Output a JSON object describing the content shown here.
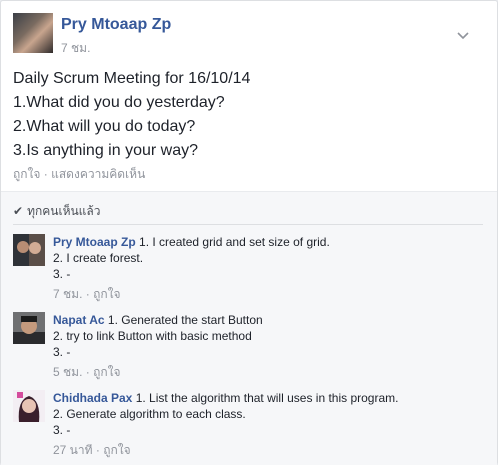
{
  "post": {
    "author": "Pry Mtoaap Zp",
    "time": "7 ชม.",
    "lines": [
      "Daily Scrum Meeting for 16/10/14",
      "1.What did you do yesterday?",
      "2.What will you do today?",
      "3.Is anything in your way?"
    ],
    "like_label": "ถูกใจ",
    "separator": "·",
    "comment_label": "แสดงความคิดเห็น"
  },
  "seen": {
    "label": "ทุกคนเห็นแล้ว",
    "icon": "check-icon"
  },
  "comments": [
    {
      "author": "Pry Mtoaap Zp",
      "first": " 1. I created grid and set size of grid.",
      "line2": "2. I create forest.",
      "line3": "3. -",
      "time": "7 ชม.",
      "like": "ถูกใจ"
    },
    {
      "author": "Napat Ac",
      "first": " 1. Generated the start Button",
      "line2": "2. try to link Button with basic method",
      "line3": "3. -",
      "time": "5 ชม.",
      "like": "ถูกใจ"
    },
    {
      "author": "Chidhada Pax",
      "first": " 1. List the algorithm that will uses in this program.",
      "line2": "2. Generate algorithm to each class.",
      "line3": "3. -",
      "time": "27 นาที",
      "like": "ถูกใจ"
    }
  ],
  "colors": {
    "link": "#365899",
    "meta": "#90949c",
    "text": "#1d2129",
    "background": "#e9ebee"
  }
}
